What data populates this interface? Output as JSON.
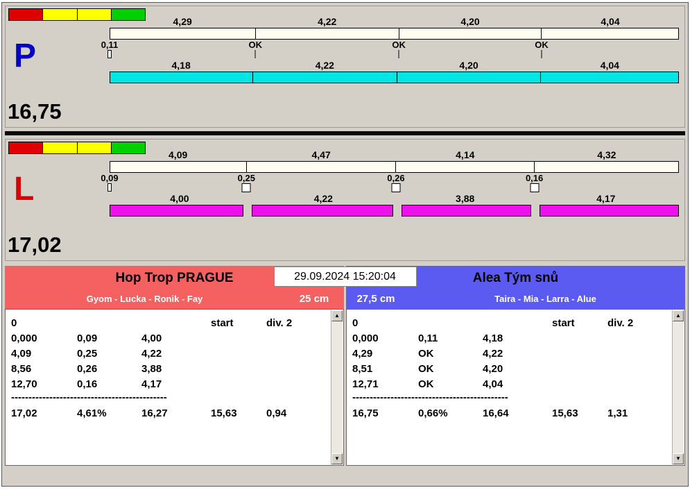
{
  "icons": {
    "scroll_up": "▲",
    "scroll_down": "▼"
  },
  "timestamp": "29.09.2024 15:20:04",
  "lanes": [
    {
      "letter": "P",
      "letter_color": "#0000cc",
      "total": "16,75",
      "indicator_colors": [
        "#e10000",
        "#ffff00",
        "#ffff00",
        "#00cf00"
      ],
      "top_splits": [
        "4,29",
        "4,22",
        "4,20",
        "4,04"
      ],
      "markers": [
        {
          "value": "0,11",
          "box": "thin"
        },
        {
          "value": "OK",
          "box": "tick"
        },
        {
          "value": "OK",
          "box": "tick"
        },
        {
          "value": "OK",
          "box": "tick"
        }
      ],
      "bottom_splits": [
        "4,18",
        "4,22",
        "4,20",
        "4,04"
      ],
      "bar_color": "#00e5e5",
      "segment_gap": 0
    },
    {
      "letter": "L",
      "letter_color": "#dd0000",
      "total": "17,02",
      "indicator_colors": [
        "#e10000",
        "#ffff00",
        "#ffff00",
        "#00cf00"
      ],
      "top_splits": [
        "4,09",
        "4,47",
        "4,14",
        "4,32"
      ],
      "markers": [
        {
          "value": "0,09",
          "box": "thin"
        },
        {
          "value": "0,25",
          "box": "square"
        },
        {
          "value": "0,26",
          "box": "square"
        },
        {
          "value": "0,16",
          "box": "square"
        }
      ],
      "bottom_splits": [
        "4,00",
        "4,22",
        "3,88",
        "4,17"
      ],
      "bar_color": "#ee11ee",
      "segment_gap": 12
    }
  ],
  "teams": [
    {
      "name": "Hop Trop PRAGUE",
      "members": "Gyom - Lucka - Ronik - Fay",
      "size": "25 cm",
      "accent": "#f56060",
      "size_side": "right",
      "zero_label": "0",
      "start_label": "start",
      "div_label": "div. 2",
      "rows": [
        [
          "0,000",
          "0,09",
          "4,00"
        ],
        [
          "4,09",
          "0,25",
          "4,22"
        ],
        [
          "8,56",
          "0,26",
          "3,88"
        ],
        [
          "12,70",
          "0,16",
          "4,17"
        ]
      ],
      "dashes": "---------------------------------------------",
      "summary": [
        "17,02",
        "4,61%",
        "16,27",
        "15,63",
        "0,94"
      ]
    },
    {
      "name": "Alea Tým snů",
      "members": "Taira - Mia - Larra - Alue",
      "size": "27,5 cm",
      "accent": "#5b5bf2",
      "size_side": "left",
      "zero_label": "0",
      "start_label": "start",
      "div_label": "div. 2",
      "rows": [
        [
          "0,000",
          "0,11",
          "4,18"
        ],
        [
          "4,29",
          "OK",
          "4,22"
        ],
        [
          "8,51",
          "OK",
          "4,20"
        ],
        [
          "12,71",
          "OK",
          "4,04"
        ]
      ],
      "dashes": "---------------------------------------------",
      "summary": [
        "16,75",
        "0,66%",
        "16,64",
        "15,63",
        "1,31"
      ]
    }
  ]
}
